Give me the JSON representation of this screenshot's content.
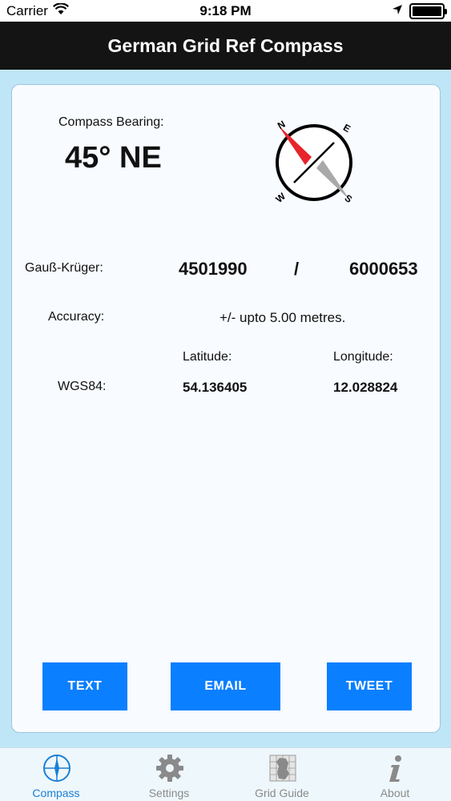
{
  "status_bar": {
    "carrier": "Carrier",
    "time": "9:18 PM"
  },
  "nav": {
    "title": "German Grid Ref Compass"
  },
  "compass": {
    "bearing_label": "Compass Bearing:",
    "bearing_value": "45° NE",
    "bearing_degrees": 45,
    "icon_letters": {
      "n": "N",
      "e": "E",
      "s": "S",
      "w": "W"
    },
    "needle_color": "#e8232b"
  },
  "gauss_kruger": {
    "label": "Gauß-Krüger:",
    "easting": "4501990",
    "separator": "/",
    "northing": "6000653"
  },
  "accuracy": {
    "label": "Accuracy:",
    "value": "+/- upto 5.00 metres."
  },
  "wgs84": {
    "label": "WGS84:",
    "latitude_label": "Latitude:",
    "longitude_label": "Longitude:",
    "latitude": "54.136405",
    "longitude": "12.028824"
  },
  "actions": {
    "text_label": "TEXT",
    "email_label": "EMAIL",
    "tweet_label": "TWEET",
    "accent": "#0a7fff"
  },
  "tabs": [
    {
      "label": "Compass",
      "icon": "compass-icon",
      "active": true
    },
    {
      "label": "Settings",
      "icon": "gear-icon",
      "active": false
    },
    {
      "label": "Grid Guide",
      "icon": "grid-map-icon",
      "active": false
    },
    {
      "label": "About",
      "icon": "info-icon",
      "active": false
    }
  ]
}
